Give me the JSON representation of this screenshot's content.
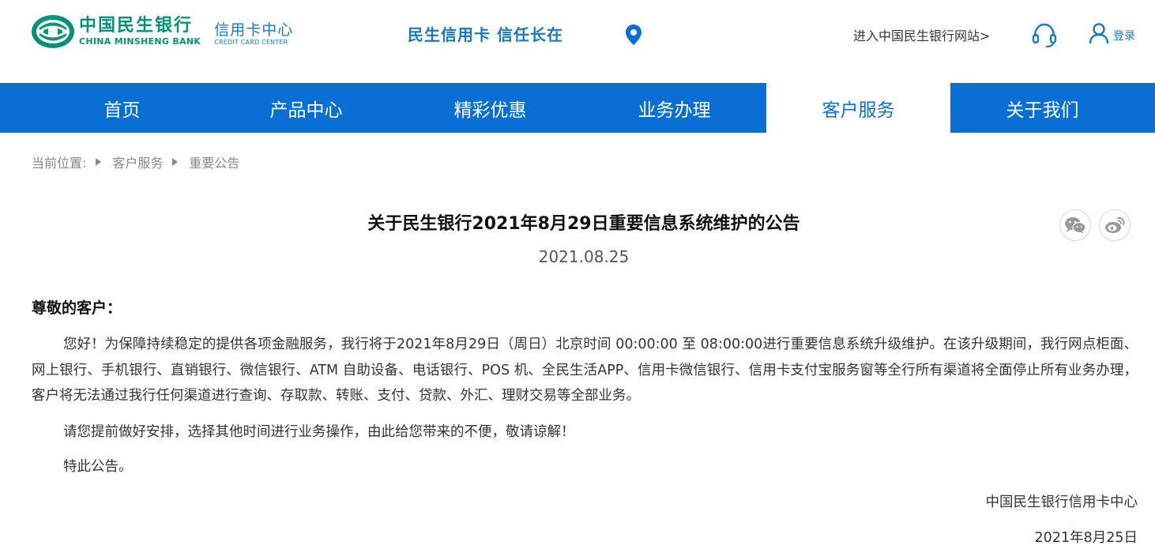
{
  "header": {
    "logo_cn": "中国民生银行",
    "logo_en": "CHINA MINSHENG BANK",
    "logo_sub_cn": "信用卡中心",
    "logo_sub_en": "CREDIT CARD CENTER",
    "slogan": "民生信用卡 信任长在",
    "site_link": "进入中国民生银行网站>",
    "login": "登录",
    "colors": {
      "brand_green": "#05927a",
      "brand_blue": "#1a78c2",
      "nav_blue": "#0a6fd4"
    },
    "icons": [
      "location-pin-icon",
      "customer-service-headset-icon",
      "user-icon"
    ]
  },
  "nav": {
    "items": [
      {
        "label": "首页",
        "active": false
      },
      {
        "label": "产品中心",
        "active": false
      },
      {
        "label": "精彩优惠",
        "active": false
      },
      {
        "label": "业务办理",
        "active": false
      },
      {
        "label": "客户服务",
        "active": true
      },
      {
        "label": "关于我们",
        "active": false
      }
    ]
  },
  "breadcrumb": {
    "prefix": "当前位置:",
    "items": [
      "客户服务",
      "重要公告"
    ]
  },
  "article": {
    "title": "关于民生银行2021年8月29日重要信息系统维护的公告",
    "date": "2021.08.25",
    "share_icons": [
      "wechat-icon",
      "weibo-icon"
    ],
    "greeting": "尊敬的客户：",
    "paragraphs": [
      "您好！为保障持续稳定的提供各项金融服务，我行将于2021年8月29日（周日）北京时间 00:00:00 至 08:00:00进行重要信息系统升级维护。在该升级期间，我行网点柜面、网上银行、手机银行、直销银行、微信银行、ATM 自助设备、电话银行、POS 机、全民生活APP、信用卡微信银行、信用卡支付宝服务窗等全行所有渠道将全面停止所有业务办理，客户将无法通过我行任何渠道进行查询、存取款、转账、支付、贷款、外汇、理财交易等全部业务。",
      "请您提前做好安排，选择其他时间进行业务操作，由此给您带来的不便，敬请谅解！",
      "特此公告。"
    ],
    "signature_org": "中国民生银行信用卡中心",
    "signature_date": "2021年8月25日"
  }
}
